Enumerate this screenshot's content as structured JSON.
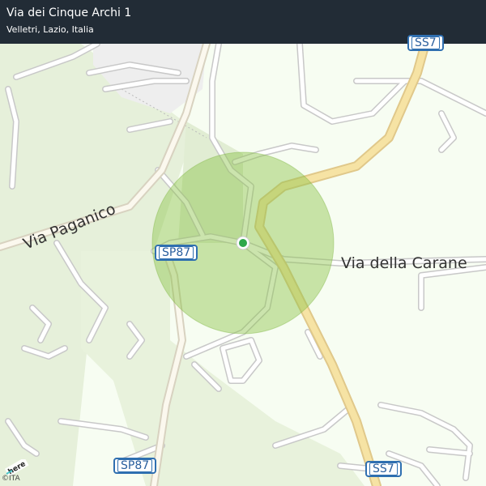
{
  "header": {
    "title": "Via dei Cinque Archi 1",
    "subtitle": "Velletri, Lazio, Italia"
  },
  "map": {
    "road_labels": {
      "via_paganico": "Via Paganico",
      "via_della_carane": "Via della Carane"
    },
    "shields": {
      "sp87_top": "SP87",
      "sp87_bottom": "SP87",
      "ss7_top": "SS7",
      "ss7_bottom": "SS7"
    },
    "marker_icon": "location-dot-icon",
    "accuracy_circle_color": "#8bc34a",
    "marker_color": "#2ea84b",
    "highway_color": "#f6e3a4"
  },
  "footer": {
    "logo_text": "here",
    "copyright": "©ITA"
  }
}
